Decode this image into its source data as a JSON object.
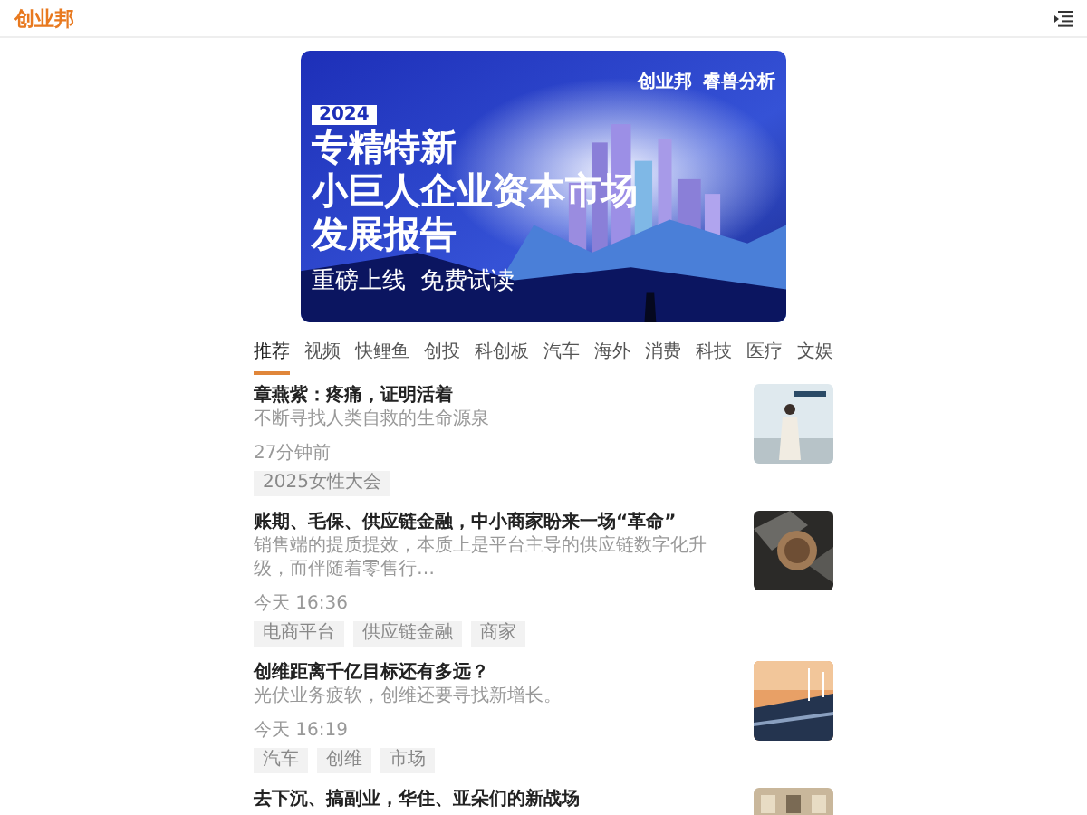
{
  "header": {
    "logo": "创业邦"
  },
  "banner": {
    "brands": [
      "创业邦",
      "睿兽分析"
    ],
    "badge": "2024",
    "title_lines": [
      "专精特新",
      "小巨人企业资本市场",
      "发展报告"
    ],
    "taglines": [
      "重磅上线",
      "免费试读"
    ]
  },
  "tabs": [
    {
      "label": "推荐",
      "selected": true
    },
    {
      "label": "视频",
      "selected": false
    },
    {
      "label": "快鲤鱼",
      "selected": false
    },
    {
      "label": "创投",
      "selected": false
    },
    {
      "label": "科创板",
      "selected": false
    },
    {
      "label": "汽车",
      "selected": false
    },
    {
      "label": "海外",
      "selected": false
    },
    {
      "label": "消费",
      "selected": false
    },
    {
      "label": "科技",
      "selected": false
    },
    {
      "label": "医疗",
      "selected": false
    },
    {
      "label": "文娱",
      "selected": false
    }
  ],
  "articles": [
    {
      "title": "章燕紫：疼痛，证明活着",
      "summary": "不断寻找人类自救的生命源泉",
      "time": "27分钟前",
      "tags": [
        "2025女性大会"
      ]
    },
    {
      "title": "账期、毛保、供应链金融，中小商家盼来一场“革命”",
      "summary": "销售端的提质提效，本质上是平台主导的供应链数字化升级，而伴随着零售行…",
      "time": "今天 16:36",
      "tags": [
        "电商平台",
        "供应链金融",
        "商家"
      ]
    },
    {
      "title": "创维距离千亿目标还有多远？",
      "summary": "光伏业务疲软，创维还要寻找新增长。",
      "time": "今天 16:19",
      "tags": [
        "汽车",
        "创维",
        "市场"
      ]
    },
    {
      "title": "去下沉、搞副业，华住、亚朵们的新战场"
    }
  ]
}
